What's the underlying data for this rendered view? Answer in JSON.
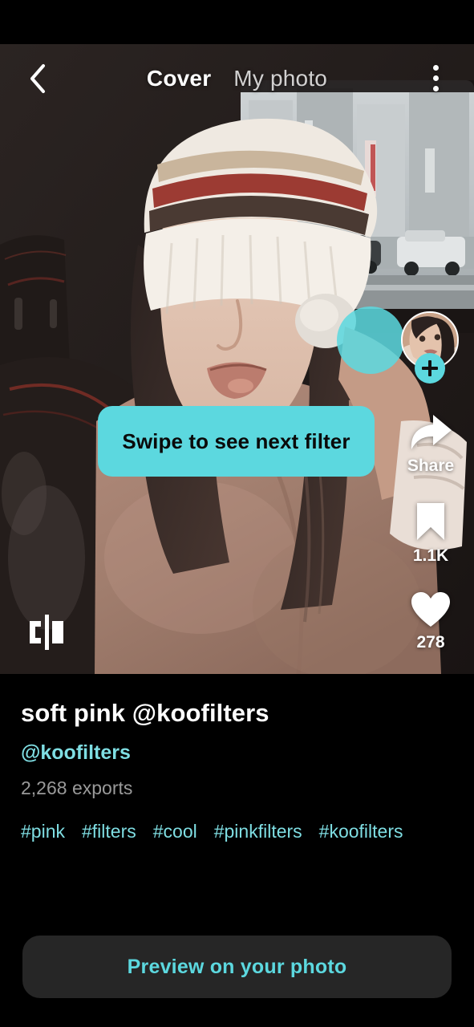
{
  "header": {
    "back_icon": "chevron-left-icon",
    "menu_icon": "kebab-menu-icon",
    "tabs": [
      {
        "label": "Cover",
        "active": true
      },
      {
        "label": "My photo",
        "active": false
      }
    ]
  },
  "photo": {
    "description": "Woman wearing a striped knit beanie sitting in a car with a city street visible through the window",
    "compare_icon": "compare-split-icon"
  },
  "tooltip": {
    "text": "Swipe to see next filter"
  },
  "creator": {
    "avatar_icon": "creator-avatar",
    "follow_icon": "plus-icon",
    "follow_label": "+"
  },
  "actions": [
    {
      "name": "share",
      "icon": "share-arrow-icon",
      "label": "Share"
    },
    {
      "name": "bookmark",
      "icon": "bookmark-icon",
      "label": "1.1K"
    },
    {
      "name": "like",
      "icon": "heart-icon",
      "label": "278"
    }
  ],
  "info": {
    "title": "soft pink @koofilters",
    "handle": "@koofilters",
    "exports": "2,268 exports",
    "tags": [
      "#pink",
      "#filters",
      "#cool",
      "#pinkfilters",
      "#koofilters"
    ]
  },
  "cta": {
    "label": "Preview on your photo"
  },
  "colors": {
    "accent_teal": "#5cd8df",
    "link_teal": "#7fdee3",
    "background": "#000000",
    "cta_background": "#262626",
    "muted_text": "#9a9a9a"
  }
}
